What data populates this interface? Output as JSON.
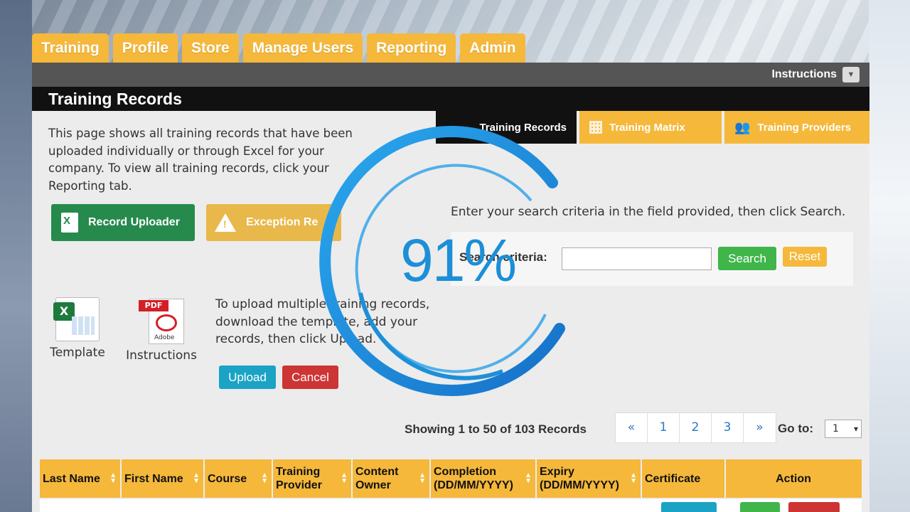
{
  "top_tabs": [
    "Training",
    "Profile",
    "Store",
    "Manage Users",
    "Reporting",
    "Admin"
  ],
  "instructions_label": "Instructions",
  "page_title": "Training Records",
  "intro_text": "This page shows all training records that have been uploaded individually or through Excel for your company. To view all training records, click your Reporting tab.",
  "buttons": {
    "record_uploader": "Record Uploader",
    "exception_report": "Exception Re",
    "upload": "Upload",
    "cancel": "Cancel",
    "search": "Search",
    "reset": "Reset"
  },
  "files": {
    "template": "Template",
    "instructions": "Instructions",
    "pdf_badge": "PDF",
    "adobe": "Adobe"
  },
  "upload_text": "To upload multiple training records, download the template, add your records, then click Upload.",
  "sub_tabs": {
    "records": "Training Records",
    "matrix": "Training Matrix",
    "providers": "Training Providers"
  },
  "search": {
    "hint": "Enter your search criteria in the field provided, then click Search.",
    "label": "Search criteria:",
    "value": ""
  },
  "pagination": {
    "showing": "Showing 1 to 50 of 103 Records",
    "pages": [
      "«",
      "1",
      "2",
      "3",
      "»"
    ],
    "goto_label": "Go to:",
    "goto_value": "1"
  },
  "table_columns": [
    "Last Name",
    "First Name",
    "Course",
    "Training Provider",
    "Content Owner",
    "Completion (DD/MM/YYYY)",
    "Expiry (DD/MM/YYYY)",
    "Certificate",
    "Action"
  ],
  "loader": {
    "percent": "91%",
    "color": "#1c8fd8"
  },
  "colors": {
    "tab": "#f5b83a",
    "green": "#268a4c",
    "cyan": "#1aa3c5",
    "red": "#cd3434"
  }
}
